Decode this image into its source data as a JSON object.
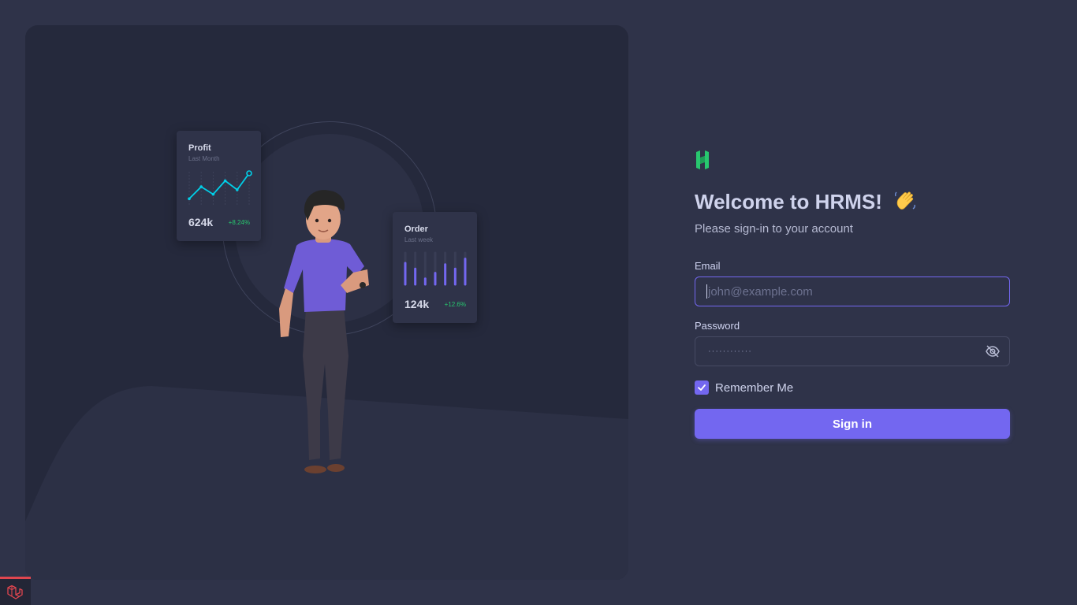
{
  "illustration": {
    "profit_card": {
      "title": "Profit",
      "subtitle": "Last Month",
      "value": "624k",
      "delta": "+8.24%",
      "line_points": [
        0.15,
        0.55,
        0.3,
        0.75,
        0.45,
        1.0
      ],
      "color": "#00cfe8"
    },
    "order_card": {
      "title": "Order",
      "subtitle": "Last week",
      "value": "124k",
      "delta": "+12.6%",
      "bars": [
        0.75,
        0.55,
        0.2,
        0.4,
        0.7,
        0.55,
        0.9
      ],
      "color": "#7367f0"
    }
  },
  "login": {
    "logo_icon": "hrms-logo-icon",
    "title": "Welcome to HRMS!",
    "wave_icon": "waving-hand-icon",
    "subtitle": "Please sign-in to your account",
    "email": {
      "label": "Email",
      "value": "",
      "placeholder": "john@example.com"
    },
    "password": {
      "label": "Password",
      "value": "············",
      "toggle_icon": "eye-off-icon"
    },
    "remember": {
      "label": "Remember Me",
      "checked": true
    },
    "submit_label": "Sign in"
  },
  "theme": {
    "background": "#2f3349",
    "panel": "#25293c",
    "accent": "#7367f0",
    "success": "#28c76f",
    "logo_green": "#28c76f"
  },
  "debugbar": {
    "icon": "laravel-icon"
  }
}
